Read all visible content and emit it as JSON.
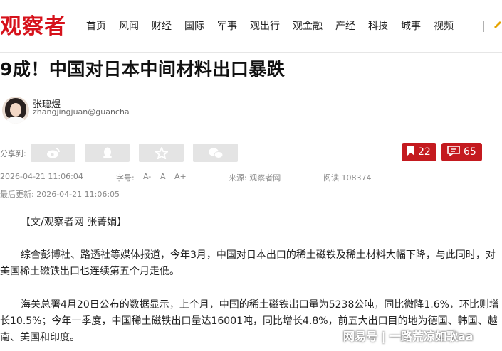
{
  "header": {
    "logo": "观察者",
    "nav": [
      "首页",
      "风闻",
      "财经",
      "国际",
      "军事",
      "观出行",
      "观金融",
      "产经",
      "科技",
      "城事",
      "视频"
    ],
    "separator": "|"
  },
  "article": {
    "title": "9成！中国对日本中间材料出口暴跌",
    "author": {
      "name": "张璁煜",
      "email": "zhangjingjuan@guancha.c"
    },
    "share": {
      "label": "分享到:",
      "platforms": [
        "weibo-icon",
        "qq-icon",
        "qzone-icon",
        "wechat-icon"
      ]
    },
    "actions": {
      "bookmark_count": "22",
      "comment_count": "65"
    },
    "meta": {
      "published": "2026-04-21 11:06:04",
      "font_label": "字号:",
      "font_small": "A-",
      "font_normal": "A",
      "font_large": "A+",
      "source": "来源:  观察者网",
      "reads": "阅读 108374",
      "updated": "最后更新: 2026-04-21 11:06:05"
    },
    "paragraphs": [
      "【文/观察者网 张菁娟】",
      "综合彭博社、路透社等媒体报道，今年3月，中国对日本出口的稀土磁铁及稀土材料大幅下降，与此同时，对美国稀土磁铁出口也连续第五个月走低。",
      "海关总署4月20日公布的数据显示，上个月，中国的稀土磁铁出口量为5238公吨，同比微降1.6%，环比则增长10.5%；今年一季度，中国稀土磁铁出口量达16001吨，同比增长4.8%，前五大出口目的地为德国、韩国、越南、美国和印度。"
    ]
  },
  "watermark": "网易号 | 一路荒凉如歌aa",
  "colors": {
    "brand_red": "#d6121b",
    "action_red": "#c41a1f",
    "share_bg": "#e4e4e4"
  }
}
